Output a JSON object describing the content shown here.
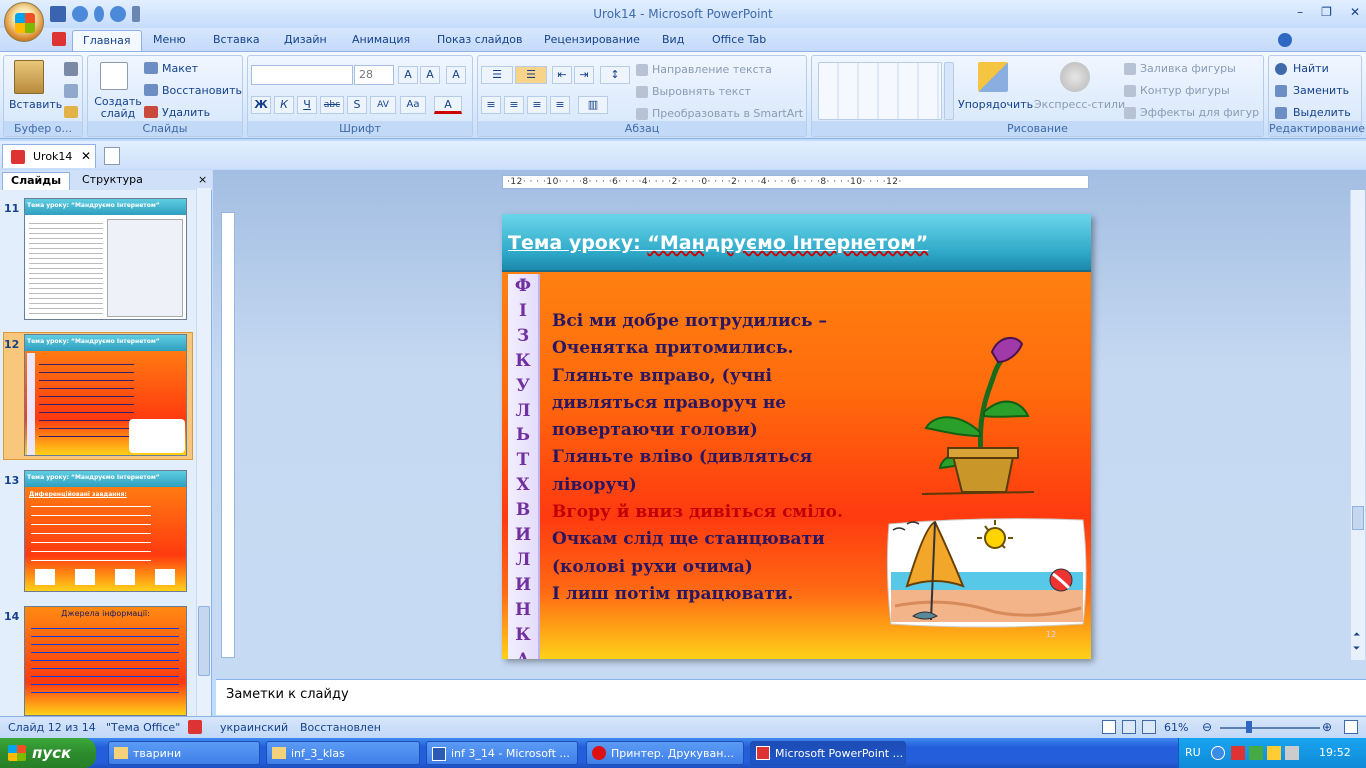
{
  "window": {
    "title": "Urok14  -  Microsoft PowerPoint",
    "controls": [
      "–",
      "❐",
      "✕"
    ]
  },
  "tabs": [
    "Главная",
    "Меню",
    "Вставка",
    "Дизайн",
    "Анимация",
    "Показ слайдов",
    "Рецензирование",
    "Вид",
    "Office Tab"
  ],
  "ribbon": {
    "clipboard": {
      "paste": "Вставить",
      "label": "Буфер о..."
    },
    "slides": {
      "new": "Создать слайд",
      "layout": "Макет",
      "reset": "Восстановить",
      "delete": "Удалить",
      "label": "Слайды"
    },
    "font": {
      "size": "28",
      "label": "Шрифт",
      "buttons": [
        "Ж",
        "К",
        "Ч",
        "abc",
        "S",
        "AV",
        "Aa",
        "A"
      ]
    },
    "paragraph": {
      "direction": "Направление текста",
      "align": "Выровнять текст",
      "smartart": "Преобразовать в SmartArt",
      "label": "Абзац"
    },
    "drawing": {
      "arrange": "Упорядочить",
      "styles": "Экспресс-стили",
      "fill": "Заливка фигуры",
      "outline": "Контур фигуры",
      "effects": "Эффекты для фигур",
      "label": "Рисование"
    },
    "editing": {
      "find": "Найти",
      "replace": "Заменить",
      "select": "Выделить",
      "label": "Редактирование"
    }
  },
  "doc_tab": {
    "name": "Urok14"
  },
  "left_pane": {
    "tabs": [
      "Слайды",
      "Структура"
    ],
    "slides": [
      {
        "num": "11",
        "title": "Тема уроку: “Мандруємо  Інтернетом”"
      },
      {
        "num": "12",
        "title": "Тема уроку: “Мандруємо  Інтернетом”"
      },
      {
        "num": "13",
        "title": "Тема уроку: “Мандруємо  Інтернетом”",
        "sub": "Диференційовані завдання:"
      },
      {
        "num": "14",
        "title": "Джерела інформації:"
      }
    ]
  },
  "ruler": {
    "horizontal": "·12· · · ·10· · · ·8· · · ·6· · · ·4· · · ·2· · · ·0· · · ·2· · · ·4· · · ·6· · · ·8· · · ·10· · · ·12·"
  },
  "slide": {
    "title_prefix": "Тема уроку",
    "title_sep": ": ",
    "title_quote": "“Мандруємо Інтернетом”",
    "vertical_word": [
      "Ф",
      "І",
      "З",
      "К",
      "У",
      "Л",
      "Ь",
      "Т",
      "Х",
      "В",
      "И",
      "Л",
      "И",
      "Н",
      "К",
      "А"
    ],
    "lines": [
      {
        "text": "Всі ми добре потрудились –",
        "color": "dk"
      },
      {
        "text": "Оченятка притомились.",
        "color": "dk"
      },
      {
        "text": "Гляньте вправо, (учні",
        "color": "dk"
      },
      {
        "text": "дивляться праворуч не",
        "color": "dk"
      },
      {
        "text": "повертаючи голови)",
        "color": "dk"
      },
      {
        "text": "Гляньте вліво (дивляться",
        "color": "dk"
      },
      {
        "text": "ліворуч)",
        "color": "dk"
      },
      {
        "text": "Вгору й вниз дивіться сміло.",
        "color": "rd"
      },
      {
        "text": "Очкам слід ще станцювати",
        "color": "dk"
      },
      {
        "text": "(колові рухи очима)",
        "color": "dk"
      },
      {
        "text": "І лиш потім працювати.",
        "color": "dk"
      }
    ],
    "number": "12"
  },
  "notes": {
    "placeholder": "Заметки к слайду"
  },
  "status": {
    "slide": "Слайд 12 из 14",
    "theme": "\"Тема Office\"",
    "lang": "украинский",
    "restored": "Восстановлен",
    "zoom": "61%"
  },
  "taskbar": {
    "start": "пуск",
    "items": [
      "тварини",
      "inf_3_klas",
      "inf 3_14 - Microsoft ...",
      "Принтер. Друкуван...",
      "Microsoft PowerPoint ..."
    ],
    "lang": "RU",
    "time": "19:52"
  }
}
